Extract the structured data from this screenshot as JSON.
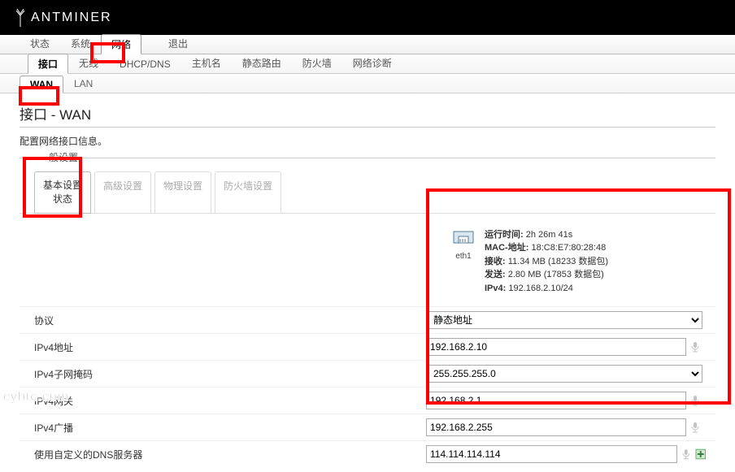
{
  "brand": "ANTMINER",
  "topnav": {
    "items": [
      "状态",
      "系统",
      "网络",
      "退出"
    ],
    "active": 2,
    "gap_after": 2
  },
  "subnav": {
    "items": [
      "接口",
      "无线",
      "DHCP/DNS",
      "主机名",
      "静态路由",
      "防火墙",
      "网络诊断"
    ],
    "active": 0
  },
  "subsubnav": {
    "items": [
      "WAN",
      "LAN"
    ],
    "active": 0
  },
  "page": {
    "title": "接口 - WAN",
    "desc": "配置网络接口信息。",
    "legend": "一般设置"
  },
  "formtabs": {
    "items": [
      "基本设置\n状态",
      "高级设置",
      "物理设置",
      "防火墙设置"
    ],
    "active": 0
  },
  "eth": {
    "iface": "eth1",
    "uptime_label": "运行时间:",
    "uptime": "2h 26m 41s",
    "mac_label": "MAC-地址:",
    "mac": "18:C8:E7:80:28:48",
    "rx_label": "接收:",
    "rx": "11.34 MB (18233 数据包)",
    "tx_label": "发送:",
    "tx": "2.80 MB (17853 数据包)",
    "ipv4_label": "IPv4:",
    "ipv4": "192.168.2.10/24"
  },
  "form": {
    "protocol_label": "协议",
    "protocol_value": "静态地址",
    "ipv4_addr_label": "IPv4地址",
    "ipv4_addr": "192.168.2.10",
    "ipv4_mask_label": "IPv4子网掩码",
    "ipv4_mask": "255.255.255.0",
    "ipv4_gw_label": "IPv4网关",
    "ipv4_gw": "192.168.2.1",
    "ipv4_bcast_label": "IPv4广播",
    "ipv4_bcast": "192.168.2.255",
    "dns_label": "使用自定义的DNS服务器",
    "dns": "114.114.114.114"
  },
  "watermark": "cybtc.com"
}
